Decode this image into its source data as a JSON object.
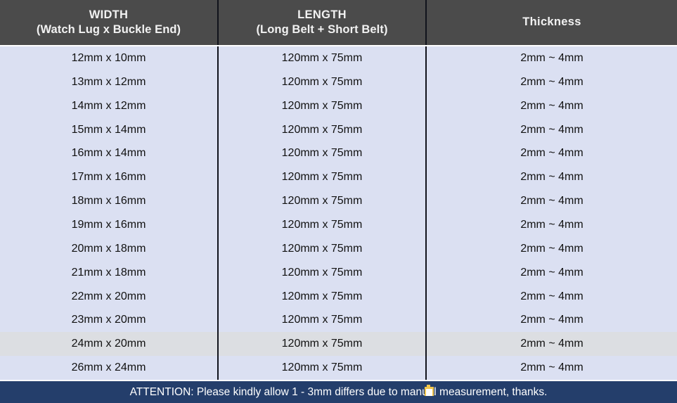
{
  "table": {
    "columns": [
      {
        "title": "WIDTH",
        "subtitle": "(Watch Lug x Buckle End)"
      },
      {
        "title": "LENGTH",
        "subtitle": "(Long Belt + Short Belt)"
      },
      {
        "title": "Thickness",
        "subtitle": ""
      }
    ],
    "rows": [
      {
        "width": "12mm x 10mm",
        "length": "120mm x 75mm",
        "thickness": "2mm ~ 4mm",
        "highlighted": false
      },
      {
        "width": "13mm x 12mm",
        "length": "120mm x 75mm",
        "thickness": "2mm ~ 4mm",
        "highlighted": false
      },
      {
        "width": "14mm x 12mm",
        "length": "120mm x 75mm",
        "thickness": "2mm ~ 4mm",
        "highlighted": false
      },
      {
        "width": "15mm x 14mm",
        "length": "120mm x 75mm",
        "thickness": "2mm ~ 4mm",
        "highlighted": false
      },
      {
        "width": "16mm x 14mm",
        "length": "120mm x 75mm",
        "thickness": "2mm ~ 4mm",
        "highlighted": false
      },
      {
        "width": "17mm x 16mm",
        "length": "120mm x 75mm",
        "thickness": "2mm ~ 4mm",
        "highlighted": false
      },
      {
        "width": "18mm x 16mm",
        "length": "120mm x 75mm",
        "thickness": "2mm ~ 4mm",
        "highlighted": false
      },
      {
        "width": "19mm x 16mm",
        "length": "120mm x 75mm",
        "thickness": "2mm ~ 4mm",
        "highlighted": false
      },
      {
        "width": "20mm x 18mm",
        "length": "120mm x 75mm",
        "thickness": "2mm ~ 4mm",
        "highlighted": false
      },
      {
        "width": "21mm x 18mm",
        "length": "120mm x 75mm",
        "thickness": "2mm ~ 4mm",
        "highlighted": false
      },
      {
        "width": "22mm x 20mm",
        "length": "120mm x 75mm",
        "thickness": "2mm ~ 4mm",
        "highlighted": false
      },
      {
        "width": "23mm x 20mm",
        "length": "120mm x 75mm",
        "thickness": "2mm ~ 4mm",
        "highlighted": false
      },
      {
        "width": "24mm x 20mm",
        "length": "120mm x 75mm",
        "thickness": "2mm ~ 4mm",
        "highlighted": true
      },
      {
        "width": "26mm x 24mm",
        "length": "120mm x 75mm",
        "thickness": "2mm ~ 4mm",
        "highlighted": false
      }
    ]
  },
  "footer": {
    "notice": "ATTENTION: Please kindly allow 1 - 3mm differs due to manual measurement, thanks.",
    "badge_icon": "yellow-badge-icon"
  },
  "colors": {
    "header_bg": "#4b4b4b",
    "header_text": "#f2f2f2",
    "cell_bg": "#dbe0f2",
    "cell_highlight_bg": "#dcdee2",
    "cell_text": "#111111",
    "divider": "#11131c",
    "footer_bg": "#243e6b",
    "footer_text": "#ffffff",
    "badge_yellow": "#f2c64b"
  }
}
